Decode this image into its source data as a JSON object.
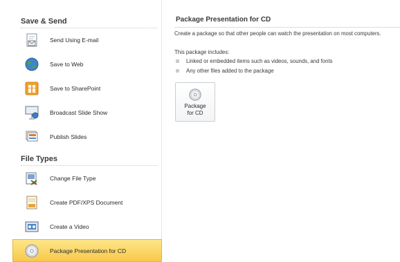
{
  "sidebar": {
    "sections": [
      {
        "title": "Save & Send"
      },
      {
        "title": "File Types"
      }
    ],
    "items": [
      {
        "label": "Send Using E-mail",
        "icon": "email-icon"
      },
      {
        "label": "Save to Web",
        "icon": "globe-icon"
      },
      {
        "label": "Save to SharePoint",
        "icon": "sharepoint-icon"
      },
      {
        "label": "Broadcast Slide Show",
        "icon": "broadcast-icon"
      },
      {
        "label": "Publish Slides",
        "icon": "publish-slides-icon"
      },
      {
        "label": "Change File Type",
        "icon": "change-file-type-icon"
      },
      {
        "label": "Create PDF/XPS Document",
        "icon": "pdf-document-icon"
      },
      {
        "label": "Create a Video",
        "icon": "video-icon"
      },
      {
        "label": "Package Presentation for CD",
        "icon": "cd-icon",
        "selected": true
      }
    ]
  },
  "content": {
    "title": "Package Presentation for CD",
    "description": "Create a package so that other people can watch the presentation on most computers.",
    "includes_header": "This package includes:",
    "includes": [
      "Linked or embedded items such as videos, sounds, and fonts",
      "Any other files added to the package"
    ],
    "button": {
      "line1": "Package",
      "line2": "for CD",
      "icon": "cd-icon"
    }
  },
  "colors": {
    "selected_bg": "#f8c84a",
    "selected_border": "#e4b43b",
    "panel_border": "#e3e6ea"
  }
}
